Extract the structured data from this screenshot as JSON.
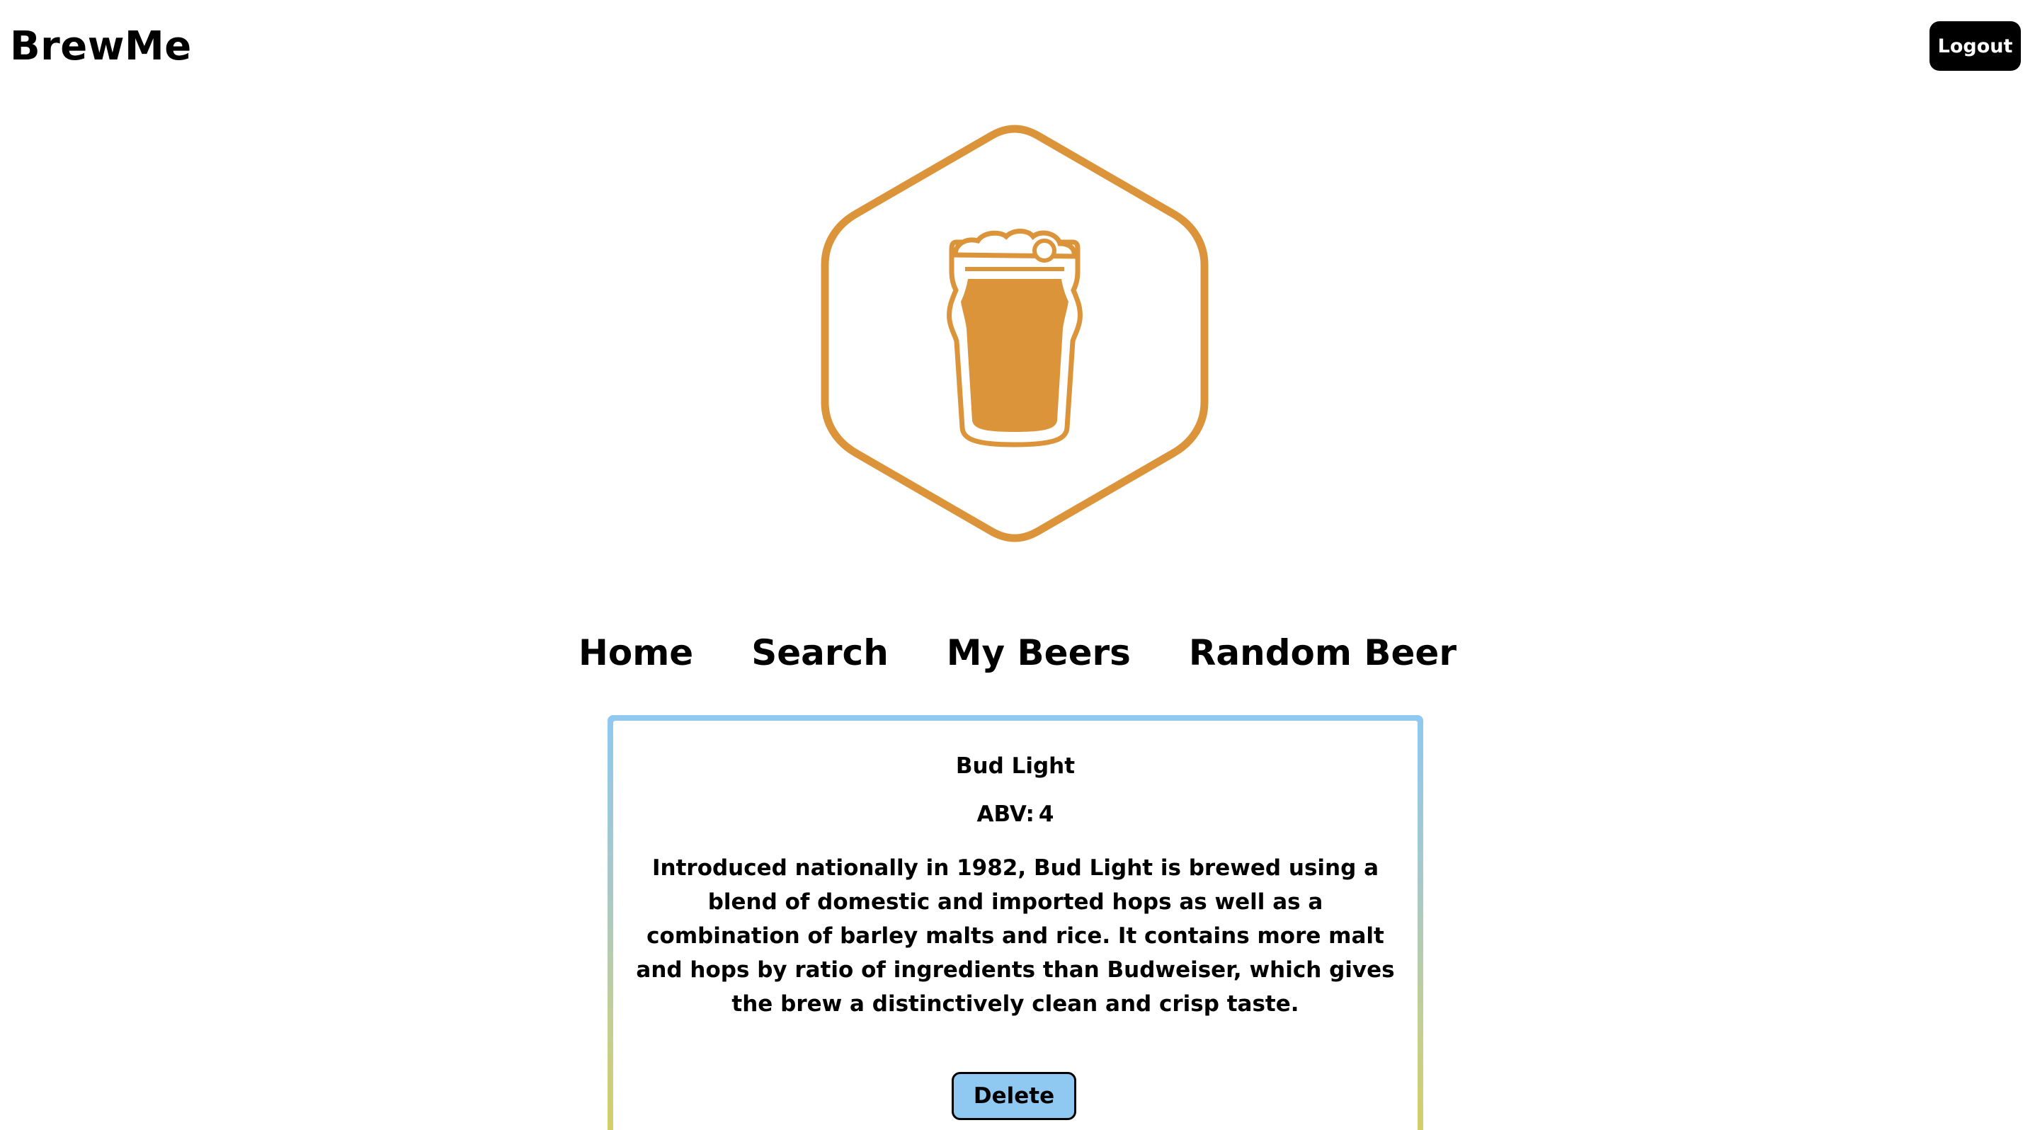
{
  "header": {
    "brand": "BrewMe",
    "logout_label": "Logout"
  },
  "logo": {
    "icon": "beer-glass-hexagon-icon",
    "accent_color": "#dc943b"
  },
  "nav": {
    "items": [
      {
        "label": "Home"
      },
      {
        "label": "Search"
      },
      {
        "label": "My Beers"
      },
      {
        "label": "Random Beer"
      }
    ]
  },
  "beer_card": {
    "name": "Bud Light",
    "abv_label": "ABV:",
    "abv_value": "4",
    "description": "Introduced nationally in 1982, Bud Light is brewed using a blend of domestic and imported hops as well as a combination of barley malts and rice. It contains more malt and hops by ratio of ingredients than Budweiser, which gives the brew a distinctively clean and crisp taste.",
    "delete_label": "Delete",
    "border_gradient": [
      "#8fc8f0",
      "#d8cf5f"
    ],
    "button_color": "#8fc8f0"
  }
}
